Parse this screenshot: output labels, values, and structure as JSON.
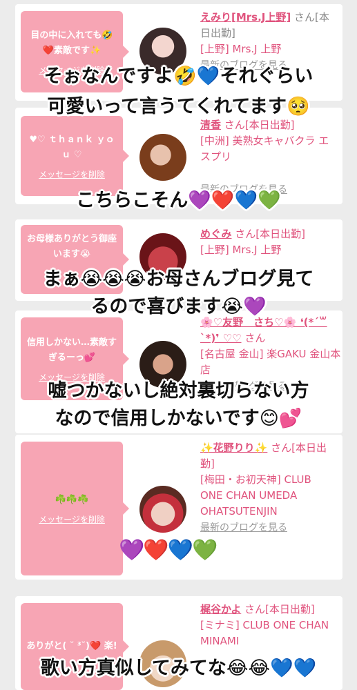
{
  "cards": [
    {
      "message": "目の中に入れても🤣❤️素敵です✨",
      "delete_label": "メッセージを削除",
      "name": "えみり[Mrs.J上野]",
      "suffix": "さん[本日出勤]",
      "shop": "[上野] Mrs.J 上野",
      "blog": "最新のブログを見る"
    },
    {
      "message": "♥︎♡ ｔｈａｎｋ ｙｏｕ ♡",
      "delete_label": "メッセージを削除",
      "name": "清香",
      "suffix": "さん[本日出勤]",
      "shop": "[中洲] 美熟女キャバクラ エスプリ",
      "blog": "最新のブログを見る"
    },
    {
      "message": "お母様ありがとう御座います😭",
      "delete_label": "",
      "name": "めぐみ",
      "suffix": "さん[本日出勤]",
      "shop": "[上野] Mrs.J 上野",
      "blog": ""
    },
    {
      "message": "信用しかない…素敵すぎるーっ💕",
      "delete_label": "メッセージを削除",
      "name": "🌸♡友野　さち♡🌸 ❛(*´꒳`*)❜ ♡♡",
      "suffix": "さん",
      "shop": "[名古屋 金山] 楽GAKU 金山本店",
      "blog": "最新のブログを見る"
    },
    {
      "message": "☘️☘️☘️",
      "delete_label": "メッセージを削除",
      "name": "✨花野りり✨",
      "suffix": "さん[本日出勤]",
      "shop": "[梅田・お初天神] CLUB ONE CHAN UMEDA OHATSUTENJIN",
      "blog": "最新のブログを見る"
    },
    {
      "message": "ありがと( ˘ ³˘)❤️ 楽!",
      "delete_label": "",
      "name": "梶谷かよ",
      "suffix": "さん[本日出勤]",
      "shop": "[ミナミ] CLUB ONE CHAN MINAMI",
      "blog": ""
    }
  ],
  "overlays": {
    "line1": "そぉなんですよ🤣💙それぐらい",
    "line2": "可愛いって言うてくれてます🥺",
    "line3": "こちらこそん💜❤️💙💚",
    "line4": "まぁ😭😭😭お母さんブログ見て",
    "line5": "るので喜びます😭💜",
    "line6": "嘘つかないし絶対裏切らない方",
    "line7": "なので信用しかないです😊💕",
    "hearts": "💜❤️💙💚",
    "line8": "歌い方真似してみてな😂😂💙💙"
  },
  "colors": {
    "bubble": "#f7a5b4",
    "name": "#e0537d",
    "background": "#ececec"
  }
}
